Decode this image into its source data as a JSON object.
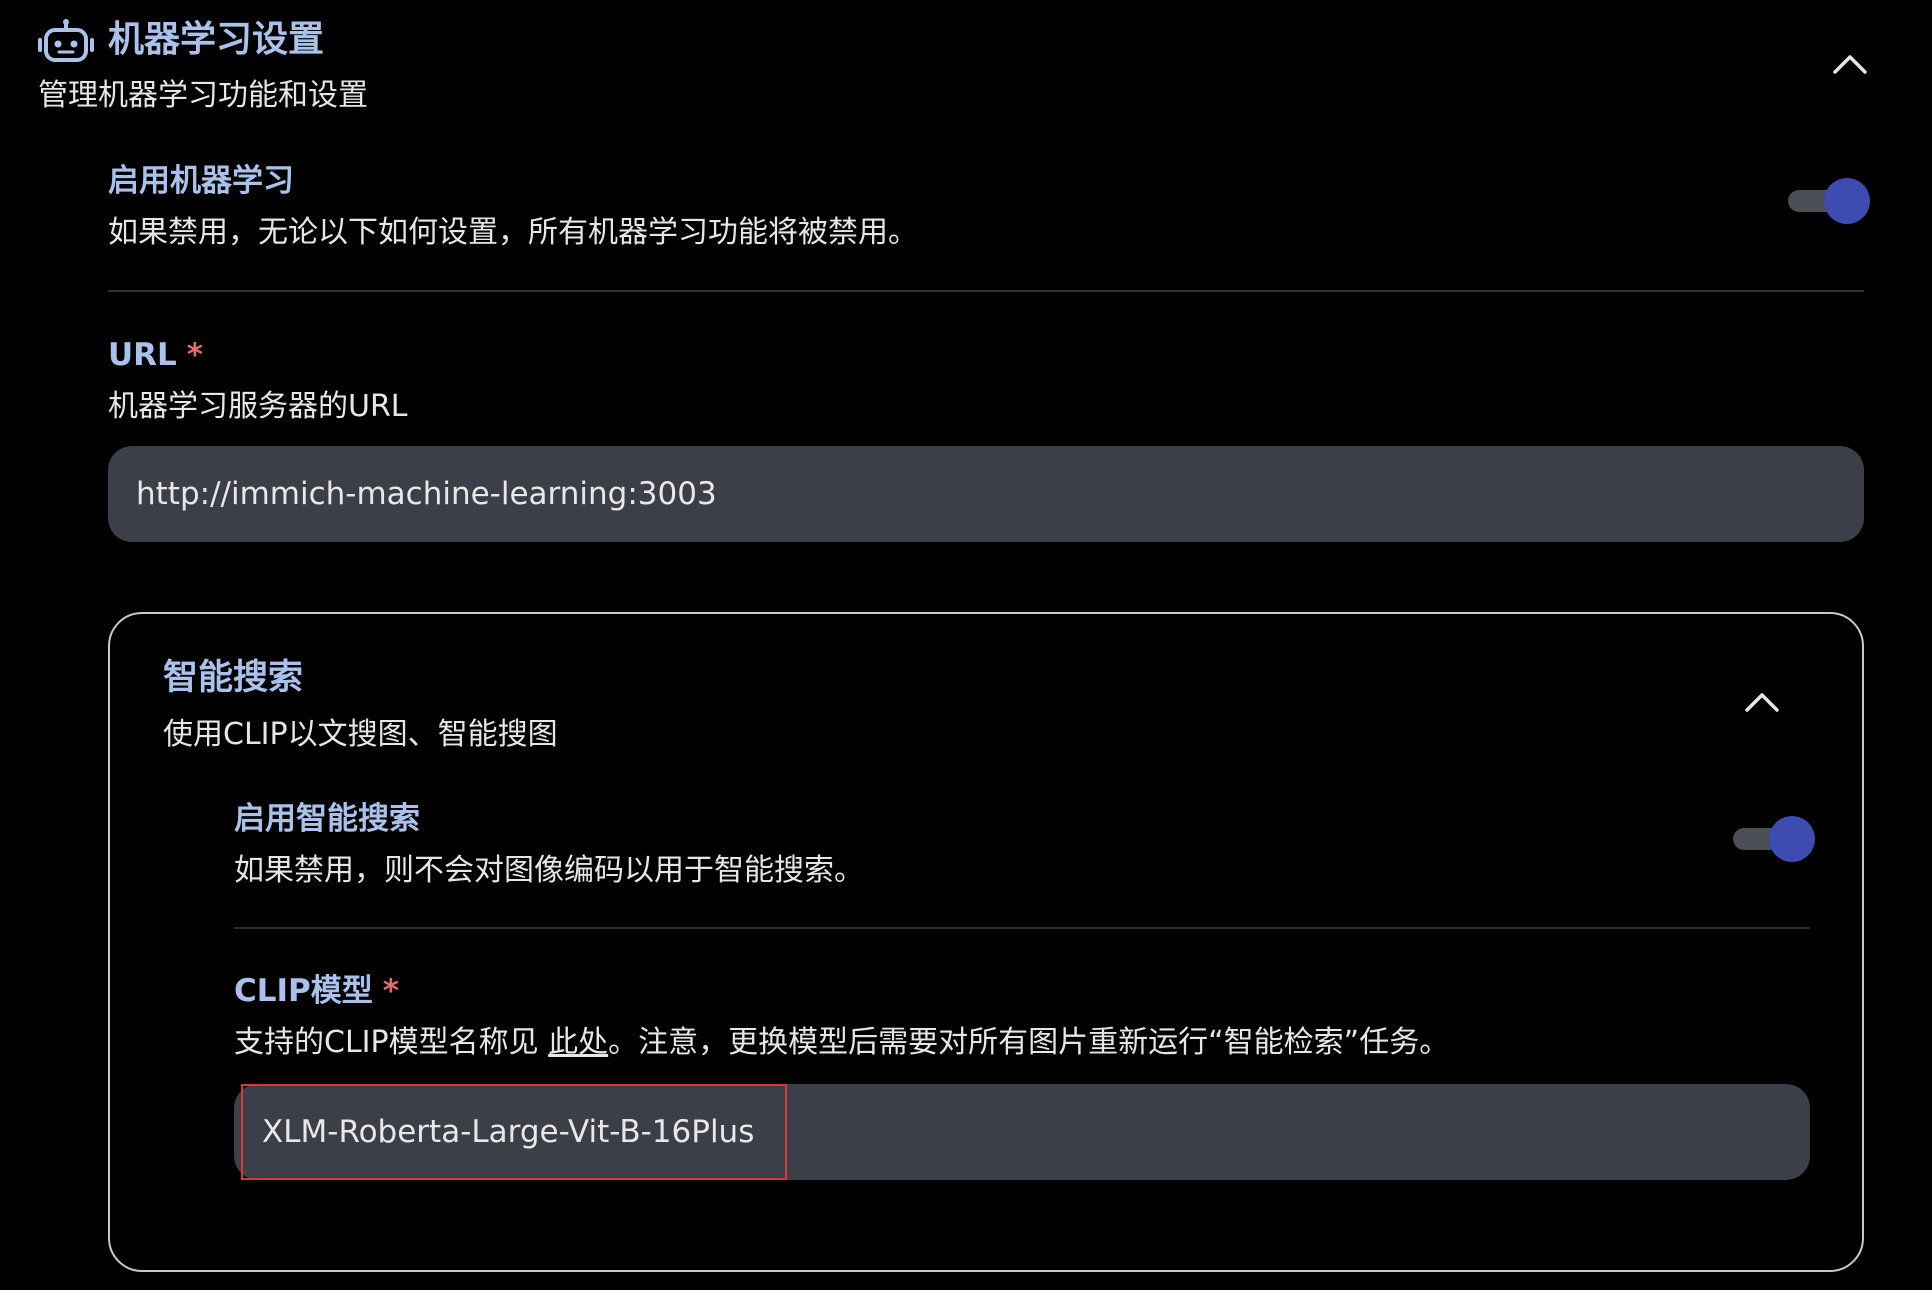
{
  "header": {
    "icon": "robot-icon",
    "title": "机器学习设置",
    "subtitle": "管理机器学习功能和设置",
    "collapse_icon": "chevron-up-icon"
  },
  "enable_ml": {
    "label": "启用机器学习",
    "description": "如果禁用，无论以下如何设置，所有机器学习功能将被禁用。",
    "enabled": true
  },
  "url": {
    "label": "URL",
    "required_mark": "*",
    "description": "机器学习服务器的URL",
    "value": "http://immich-machine-learning:3003"
  },
  "smart_search": {
    "title": "智能搜索",
    "subtitle": "使用CLIP以文搜图、智能搜图",
    "collapse_icon": "chevron-up-icon",
    "enable": {
      "label": "启用智能搜索",
      "description": "如果禁用，则不会对图像编码以用于智能搜索。",
      "enabled": true
    },
    "clip_model": {
      "label": "CLIP模型",
      "required_mark": "*",
      "description_before": "支持的CLIP模型名称见 ",
      "link_text": "此处",
      "description_after": "。注意，更换模型后需要对所有图片重新运行“智能检索”任务。",
      "value": "XLM-Roberta-Large-Vit-B-16Plus"
    }
  },
  "colors": {
    "accent_text": "#a9c2ec",
    "toggle_on": "#3e4bb0",
    "required": "#e86a6a",
    "highlight": "#d33a3a"
  }
}
